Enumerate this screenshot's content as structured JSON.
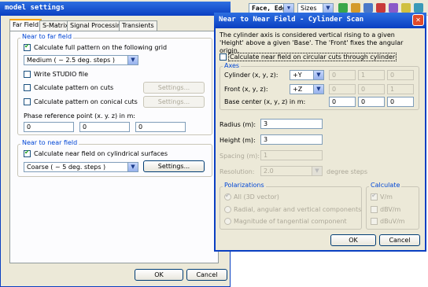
{
  "background_toolbar": {
    "combo1": "Face, Edge",
    "combo2": "Sizes"
  },
  "model_settings": {
    "title": "model settings",
    "tabs": [
      "Far Field",
      "S-Matrix",
      "Signal Processing",
      "Transients"
    ],
    "near_to_far": {
      "label": "Near to far field",
      "calc_full_pattern": "Calculate full pattern on the following grid",
      "grid_select": "Medium ( ~ 2.5 deg. steps )",
      "write_studio": "Write STUDIO file",
      "calc_on_cuts": "Calculate pattern on cuts",
      "calc_on_conical_cuts": "Calculate pattern on conical cuts",
      "settings_label": "Settings...",
      "phase_ref_label": "Phase reference point (x. y. z) in m:",
      "phase_x": "0",
      "phase_y": "0",
      "phase_z": "0"
    },
    "near_to_near": {
      "label": "Near to near field",
      "calc_cylindrical": "Calculate near field on cylindrical surfaces",
      "step_select": "Coarse ( ~ 5 deg. steps )",
      "settings_label": "Settings..."
    },
    "ok": "OK",
    "cancel": "Cancel"
  },
  "cylinder_scan": {
    "title": "Near to Near Field - Cylinder Scan",
    "description": "The cylinder axis is considered vertical rising to a given 'Height' above a given 'Base'. The 'Front' fixes the angular origin.",
    "calc_circular_cuts": "Calculate near field on circular cuts through cylinder",
    "axes": {
      "label": "Axes",
      "cylinder_label": "Cylinder (x, y, z):",
      "cylinder_select": "+Y",
      "cylinder_vals": [
        "0",
        "1",
        "0"
      ],
      "front_label": "Front (x, y, z):",
      "front_select": "+Z",
      "front_vals": [
        "0",
        "0",
        "1"
      ],
      "base_label": "Base center (x, y, z) in m:",
      "base_vals": [
        "0",
        "0",
        "0"
      ]
    },
    "radius_label": "Radius (m):",
    "radius_value": "3",
    "height_label": "Height (m):",
    "height_value": "3",
    "spacing_label": "Spacing (m):",
    "spacing_value": "1",
    "resolution_label": "Resolution:",
    "resolution_value": "2.0",
    "resolution_unit": "degree steps",
    "polarizations": {
      "label": "Polarizations",
      "all": "All (3D vector)",
      "radial": "Radial, angular and vertical components",
      "magnitude": "Magnitude of tangential component"
    },
    "calculate": {
      "label": "Calculate",
      "vm": "V/m",
      "dbv": "dBV/m",
      "dbuv": "dBuV/m"
    },
    "ok": "OK",
    "cancel": "Cancel"
  }
}
